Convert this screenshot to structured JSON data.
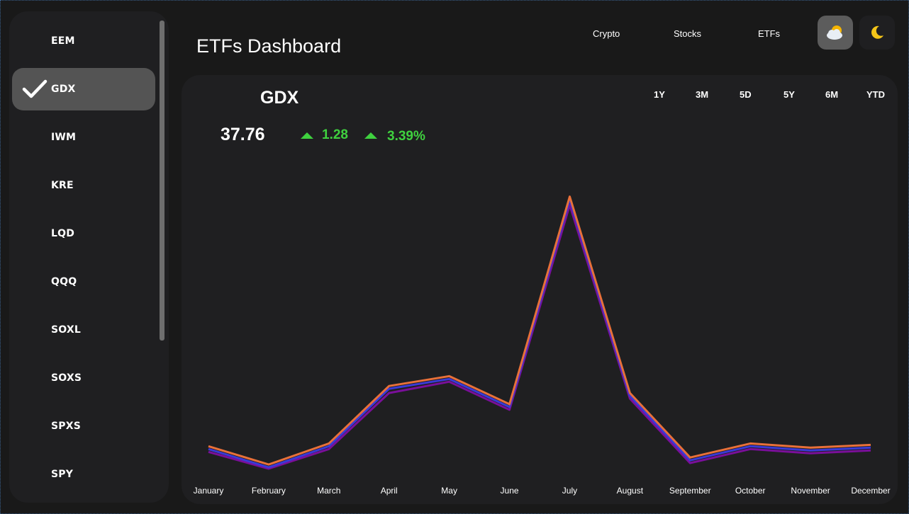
{
  "sidebar": {
    "items": [
      {
        "label": "EEM",
        "active": false
      },
      {
        "label": "GDX",
        "active": true
      },
      {
        "label": "IWM",
        "active": false
      },
      {
        "label": "KRE",
        "active": false
      },
      {
        "label": "LQD",
        "active": false
      },
      {
        "label": "QQQ",
        "active": false
      },
      {
        "label": "SOXL",
        "active": false
      },
      {
        "label": "SOXS",
        "active": false
      },
      {
        "label": "SPXS",
        "active": false
      },
      {
        "label": "SPY",
        "active": false
      }
    ]
  },
  "header": {
    "title": "ETFs Dashboard",
    "nav": [
      "Crypto",
      "Stocks",
      "ETFs"
    ],
    "theme_icons": [
      "partly-cloudy-icon",
      "moon-icon"
    ]
  },
  "summary": {
    "ticker": "GDX",
    "price": "37.76",
    "change": "1.28",
    "change_pct": "3.39%"
  },
  "ranges": [
    "1Y",
    "3M",
    "5D",
    "5Y",
    "6M",
    "YTD"
  ],
  "colors": {
    "up": "#3fd13f",
    "line_orange": "#e8703a",
    "line_blue": "#3a3ad6",
    "line_purple": "#7a0f9a"
  },
  "chart_data": {
    "type": "line",
    "categories": [
      "January",
      "February",
      "March",
      "April",
      "May",
      "June",
      "July",
      "August",
      "September",
      "October",
      "November",
      "December"
    ],
    "series": [
      {
        "color": "#7a0f9a",
        "values": [
          14,
          2,
          16,
          56,
          64,
          44,
          190,
          52,
          6,
          16,
          13,
          15
        ]
      },
      {
        "color": "#3a3ad6",
        "values": [
          16,
          3,
          18,
          59,
          66,
          46,
          194,
          54,
          8,
          18,
          15,
          17
        ]
      },
      {
        "color": "#e8703a",
        "values": [
          18,
          5,
          20,
          61,
          68,
          48,
          196,
          56,
          10,
          20,
          17,
          19
        ]
      }
    ],
    "ylim": [
      0,
      210
    ],
    "grid": false,
    "legend": "none"
  }
}
